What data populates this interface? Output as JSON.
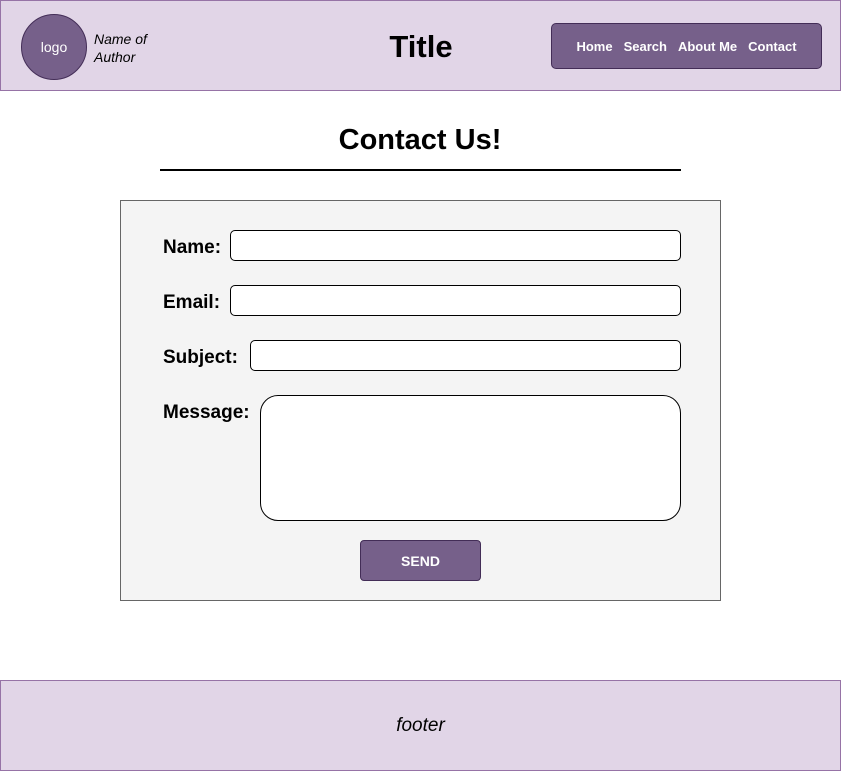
{
  "header": {
    "logo_text": "logo",
    "author": "Name of Author",
    "title": "Title",
    "nav": [
      {
        "label": "Home"
      },
      {
        "label": "Search"
      },
      {
        "label": "About Me"
      },
      {
        "label": "Contact"
      }
    ]
  },
  "main": {
    "heading": "Contact Us!",
    "form": {
      "name_label": "Name:",
      "name_value": "",
      "email_label": "Email:",
      "email_value": "",
      "subject_label": "Subject:",
      "subject_value": "",
      "message_label": "Message:",
      "message_value": "",
      "send_label": "SEND"
    }
  },
  "footer": {
    "text": "footer"
  },
  "colors": {
    "accent": "#76608a",
    "accent_border": "#432d57",
    "header_bg": "#e1d5e7",
    "header_border": "#9673a6",
    "panel_bg": "#f4f4f4"
  }
}
